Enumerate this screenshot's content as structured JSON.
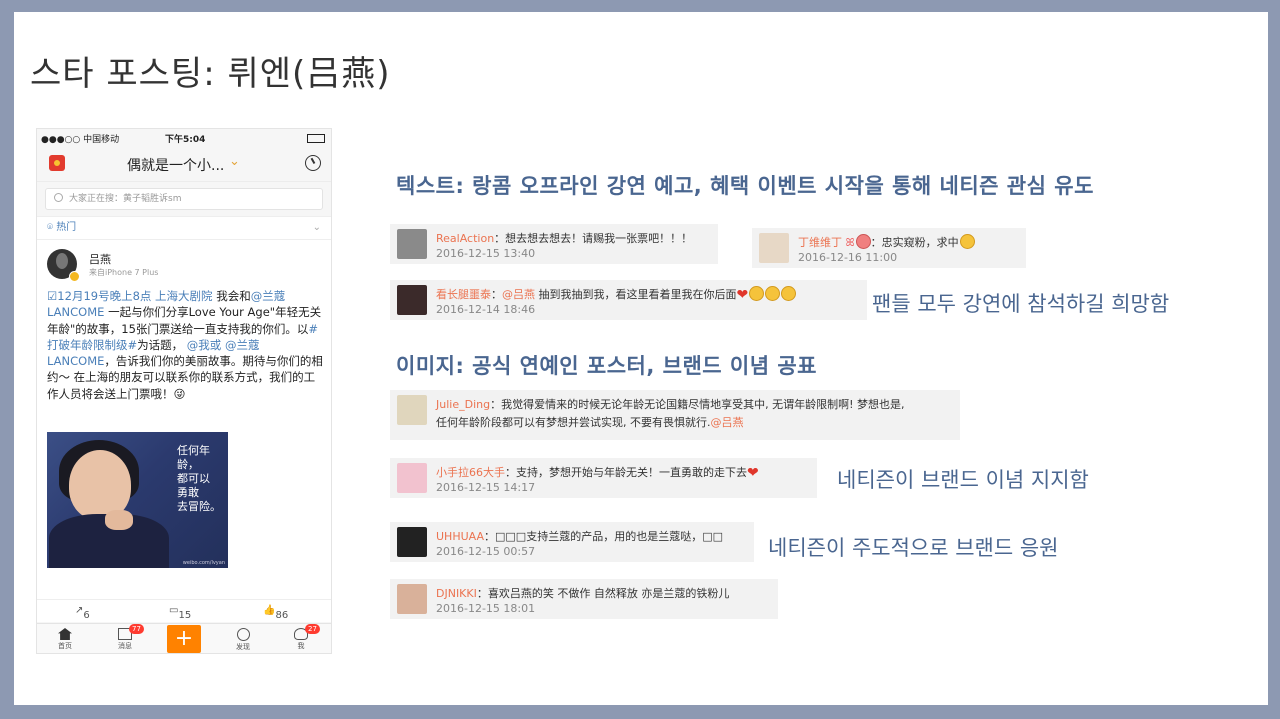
{
  "slide": {
    "title": "스타 포스팅: 뤼엔(吕燕)",
    "heading_text": "텍스트: 랑콤 오프라인 강연 예고, 혜택 이벤트 시작을 통해 네티즌 관심 유도",
    "heading_image": "이미지: 공식 연예인 포스터, 브랜드 이념 공표",
    "note_fans": "팬들 모두 강연에 참석하길 희망함",
    "note_support": "네티즌이 브랜드 이념 지지함",
    "note_lead": "네티즌이 주도적으로 브랜드 응원"
  },
  "phone": {
    "status": {
      "carrier": "●●●○○ 中国移动",
      "time": "下午5:04"
    },
    "nav_title": "偶就是一个小...",
    "nav_chevron": "⌄",
    "search_placeholder": "大家正在搜：黄子韬胜诉sm",
    "hot_label": "热门",
    "hot_chevron": "⌄",
    "post": {
      "name": "吕燕",
      "source": "来自iPhone 7 Plus",
      "text_link1": "☑12月19号晚上8点 上海大剧院",
      "text_part1": " 我会和",
      "text_link2": "@兰蔻LANCOME",
      "text_part2": " 一起与你们分享Love Your Age\"年轻无关年龄\"的故事，15张门票送给一直支持我的你们。以",
      "text_link3": "#打破年龄限制级#",
      "text_part3": "为话题， ",
      "text_link4": "@我或 @兰蔻LANCOME",
      "text_part4": "，告诉我们你的美丽故事。期待与你们的相约～ 在上海的朋友可以联系你的联系方式，我们的工作人员将会送上门票哦！",
      "emoji": "😜",
      "image_text": [
        "任何年龄，",
        "都可以",
        "勇敢",
        "去冒险。"
      ],
      "image_caption": "weibo.com/lvyan"
    },
    "actions": {
      "repost": "6",
      "comment": "15",
      "like": "86"
    },
    "tabs": [
      {
        "label": "首页"
      },
      {
        "label": "消息",
        "badge": "77"
      },
      {
        "label": "发现"
      },
      {
        "label": "我",
        "badge": "27"
      }
    ],
    "plus": "+"
  },
  "comments": [
    {
      "user": "RealAction",
      "text": "：想去想去想去！请赐我一张票吧！！！",
      "date": "2016-12-15 13:40"
    },
    {
      "user": "丁维维丁",
      "text": "：忠实窥粉，求中",
      "date": "2016-12-16 11:00"
    },
    {
      "user": "看长腿噩泰",
      "text": "：",
      "at": "@吕燕",
      "text2": " 抽到我抽到我，看这里看着里我在你后面",
      "date": "2016-12-14 18:46"
    },
    {
      "user": "Julie_Ding",
      "text": "：我觉得爱情来的时候无论年龄无论国籍尽情地享受其中, 无谓年龄限制啊! 梦想也是,",
      "line2": "任何年龄阶段都可以有梦想并尝试实现, 不要有畏惧就行.",
      "at": "@吕燕",
      "date": ""
    },
    {
      "user": "小手拉66大手",
      "text": "：支持，梦想开始与年龄无关！一直勇敢的走下去",
      "date": "2016-12-15 14:17"
    },
    {
      "user": "UHHUAA",
      "text": "：□□□支持兰蔻的产品，用的也是兰蔻哒，□□",
      "date": "2016-12-15 00:57"
    },
    {
      "user": "DJNIKKI",
      "text": "：喜欢吕燕的笑 不做作 自然释放 亦是兰蔻的铁粉儿",
      "date": "2016-12-15 18:01"
    }
  ]
}
